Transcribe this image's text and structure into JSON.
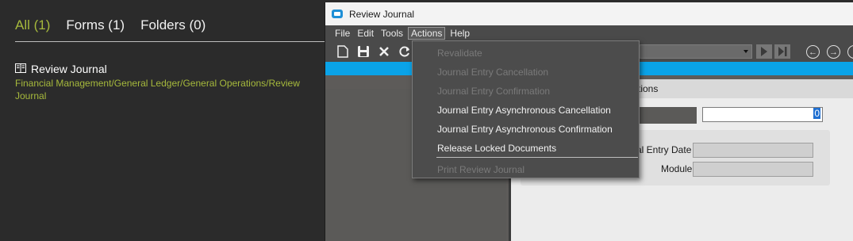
{
  "search": {
    "tabs": [
      {
        "label": "All (1)",
        "active": true
      },
      {
        "label": "Forms (1)",
        "active": false
      },
      {
        "label": "Folders (0)",
        "active": false
      }
    ],
    "results": [
      {
        "icon": "book-icon",
        "title": "Review Journal",
        "path": "Financial Management/General Ledger/General Operations/Review Journal"
      }
    ]
  },
  "window": {
    "title": "Review Journal",
    "menu": [
      "File",
      "Edit",
      "Tools",
      "Actions",
      "Help"
    ],
    "open_menu": "Actions",
    "toolbar_icons": [
      "new-document-icon",
      "save-icon",
      "delete-icon",
      "refresh-icon"
    ],
    "tab_label": "...tions",
    "numeric_field_value": "0",
    "fields": [
      {
        "label": "...al Entry Date",
        "value": ""
      },
      {
        "label": "Module",
        "value": ""
      }
    ]
  },
  "actions_menu": {
    "items": [
      {
        "label": "Revalidate",
        "enabled": false
      },
      {
        "label": "Journal Entry Cancellation",
        "enabled": false
      },
      {
        "label": "Journal Entry Confirmation",
        "enabled": false
      },
      {
        "label": "Journal Entry Asynchronous Cancellation",
        "enabled": true
      },
      {
        "label": "Journal Entry Asynchronous Confirmation",
        "enabled": true
      },
      {
        "label": "Release Locked Documents",
        "enabled": true
      },
      {
        "label": "Print Review Journal",
        "enabled": false
      }
    ]
  },
  "colors": {
    "accent_green": "#a6b93c",
    "blue_bar": "#0aa3e8"
  }
}
